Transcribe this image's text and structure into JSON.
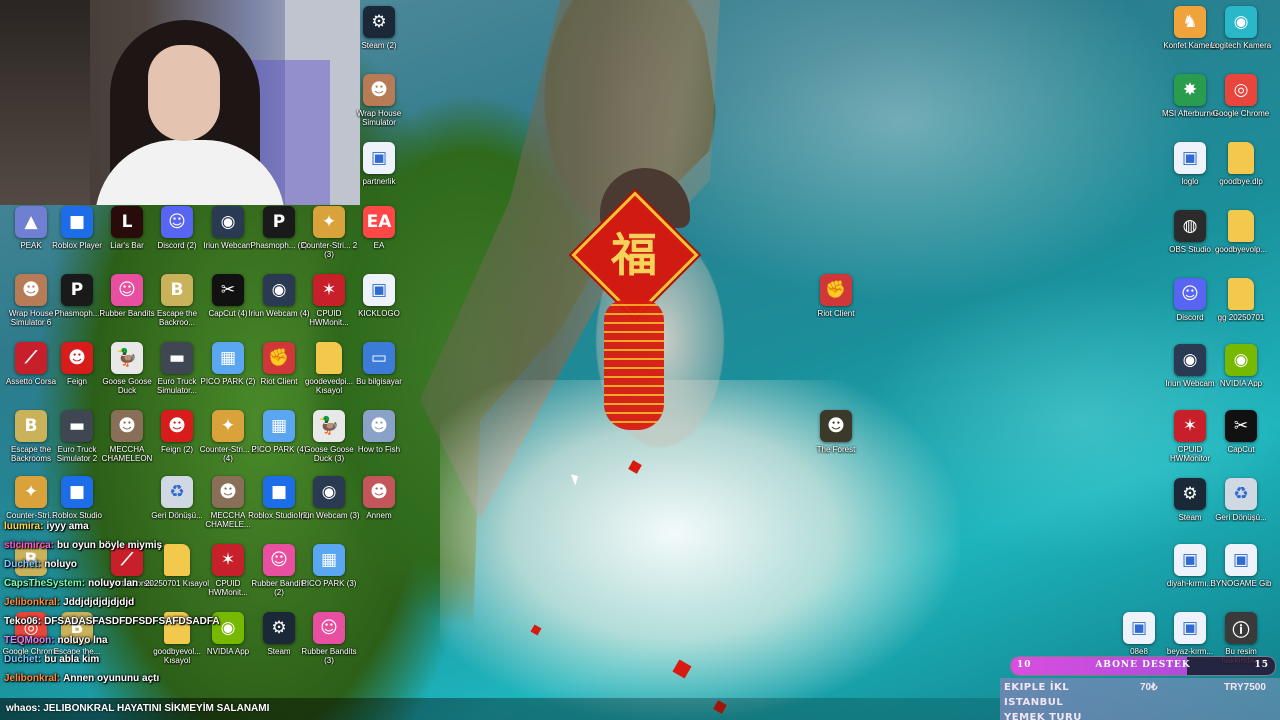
{
  "colors": {
    "steam": "#1b2838",
    "discord": "#5865f2",
    "roblox": "#1e6de8",
    "cpuid": "#c8202b",
    "riot": "#d13639",
    "ea": "#ff4747",
    "nvidia": "#76b900",
    "chrome": "#ffffff",
    "folder": "#f2c94c",
    "goal": "#c84fdc"
  },
  "desktop_icons": [
    {
      "label": "Steam (2)",
      "icon": "steam-icon",
      "col": 0
    },
    {
      "label": "Wrap House Simulator",
      "icon": "game-icon"
    },
    {
      "label": "partnerlik",
      "icon": "image-file-icon"
    },
    {
      "label": "PEAK",
      "icon": "peak-icon"
    },
    {
      "label": "Roblox Player",
      "icon": "roblox-icon"
    },
    {
      "label": "Liar's Bar",
      "icon": "liars-bar-icon"
    },
    {
      "label": "Discord (2)",
      "icon": "discord-icon"
    },
    {
      "label": "Iriun Webcam",
      "icon": "webcam-icon"
    },
    {
      "label": "Phasmoph... (2)",
      "icon": "phasmophobia-icon"
    },
    {
      "label": "Counter-Stri... 2 (3)",
      "icon": "counter-strike-icon"
    },
    {
      "label": "EA",
      "icon": "ea-icon"
    },
    {
      "label": "Wrap House Simulator 6",
      "icon": "game-icon"
    },
    {
      "label": "Phasmoph...",
      "icon": "phasmophobia-icon"
    },
    {
      "label": "Rubber Bandits",
      "icon": "rubber-bandits-icon"
    },
    {
      "label": "Escape the Backroo...",
      "icon": "backrooms-icon"
    },
    {
      "label": "CapCut (4)",
      "icon": "capcut-icon"
    },
    {
      "label": "Iriun Webcam (4)",
      "icon": "webcam-icon"
    },
    {
      "label": "CPUID HWMonit...",
      "icon": "cpuid-icon"
    },
    {
      "label": "KICKLOGO",
      "icon": "image-file-icon"
    },
    {
      "label": "Riot Client",
      "icon": "riot-icon"
    },
    {
      "label": "Assetto Corsa",
      "icon": "assetto-corsa-icon"
    },
    {
      "label": "Feign",
      "icon": "feign-icon"
    },
    {
      "label": "Goose Goose Duck",
      "icon": "goose-icon"
    },
    {
      "label": "Euro Truck Simulator...",
      "icon": "truck-icon"
    },
    {
      "label": "PICO PARK (2)",
      "icon": "pico-park-icon"
    },
    {
      "label": "Riot Client",
      "icon": "riot-icon"
    },
    {
      "label": "goodevedpi... Kısayol",
      "icon": "folder-icon"
    },
    {
      "label": "Bu bilgisayar",
      "icon": "computer-icon"
    },
    {
      "label": "Escape the Backrooms",
      "icon": "backrooms-icon"
    },
    {
      "label": "Euro Truck Simulator 2",
      "icon": "truck-icon"
    },
    {
      "label": "MECCHA CHAMELEON",
      "icon": "chameleon-icon"
    },
    {
      "label": "Feign (2)",
      "icon": "feign-icon"
    },
    {
      "label": "Counter-Stri... 2 (4)",
      "icon": "counter-strike-icon"
    },
    {
      "label": "PICO PARK (4)",
      "icon": "pico-park-icon"
    },
    {
      "label": "Goose Goose Duck (3)",
      "icon": "goose-icon"
    },
    {
      "label": "How to Fish",
      "icon": "fish-icon"
    },
    {
      "label": "The Forest",
      "icon": "forest-icon"
    },
    {
      "label": "Counter-Stri...",
      "icon": "counter-strike-icon"
    },
    {
      "label": "Roblox Studio",
      "icon": "roblox-icon"
    },
    {
      "label": "Geri Dönüşü...",
      "icon": "recycle-bin-icon"
    },
    {
      "label": "MECCHA CHAMELE...",
      "icon": "chameleon-icon"
    },
    {
      "label": "Roblox Studio (2)",
      "icon": "roblox-icon"
    },
    {
      "label": "Iriun Webcam (3)",
      "icon": "webcam-icon"
    },
    {
      "label": "Annem",
      "icon": "annem-icon"
    },
    {
      "label": "Backrooms",
      "icon": "backrooms-icon"
    },
    {
      "label": "Assetto Corsa",
      "icon": "assetto-corsa-icon"
    },
    {
      "label": "20250701 Kısayol",
      "icon": "folder-icon"
    },
    {
      "label": "CPUID HWMonit...",
      "icon": "cpuid-icon"
    },
    {
      "label": "Rubber Bandits (2)",
      "icon": "rubber-bandits-icon"
    },
    {
      "label": "PICO PARK (3)",
      "icon": "pico-park-icon"
    },
    {
      "label": "Google Chrome",
      "icon": "chrome-icon"
    },
    {
      "label": "Escape the...",
      "icon": "backrooms-icon"
    },
    {
      "label": "goodbyevol... Kısayol",
      "icon": "folder-icon"
    },
    {
      "label": "NVIDIA App",
      "icon": "nvidia-icon"
    },
    {
      "label": "Steam",
      "icon": "steam-icon"
    },
    {
      "label": "Rubber Bandits (3)",
      "icon": "rubber-bandits-icon"
    },
    {
      "label": "Konfet Kamera",
      "icon": "konfet-icon"
    },
    {
      "label": "Logitech Kamera",
      "icon": "logitech-icon"
    },
    {
      "label": "MSI Afterburner",
      "icon": "msi-icon"
    },
    {
      "label": "Google Chrome",
      "icon": "chrome-icon"
    },
    {
      "label": "loglo",
      "icon": "image-file-icon"
    },
    {
      "label": "goodbye.dlp",
      "icon": "folder-icon"
    },
    {
      "label": "OBS Studio",
      "icon": "obs-icon"
    },
    {
      "label": "goodbyevolp...",
      "icon": "folder-icon"
    },
    {
      "label": "Discord",
      "icon": "discord-icon"
    },
    {
      "label": "gg 20250701",
      "icon": "folder-icon"
    },
    {
      "label": "Iriun Webcam",
      "icon": "webcam-icon"
    },
    {
      "label": "NVIDIA App",
      "icon": "nvidia-icon"
    },
    {
      "label": "CPUID HWMonitor",
      "icon": "cpuid-icon"
    },
    {
      "label": "CapCut",
      "icon": "capcut-icon"
    },
    {
      "label": "Steam",
      "icon": "steam-icon"
    },
    {
      "label": "Geri Dönüşü...",
      "icon": "recycle-bin-icon"
    },
    {
      "label": "diyah-kırmı...",
      "icon": "image-file-icon"
    },
    {
      "label": "BYNOGAME Gib",
      "icon": "image-file-icon"
    },
    {
      "label": "08e8",
      "icon": "image-file-icon"
    },
    {
      "label": "beyaz-kırm...",
      "icon": "image-file-icon"
    },
    {
      "label": "Bu resim hakkında...",
      "icon": "info-icon"
    }
  ],
  "chat": [
    {
      "user": "luumira:",
      "text": "iyyy ama",
      "user_color": "#ffd84a"
    },
    {
      "user": "sticimirca:",
      "text": "bu oyun böyle miymiş",
      "user_color": "#ff5ad1"
    },
    {
      "user": "Duchet:",
      "text": "noluyo",
      "user_color": "#7ec8ff"
    },
    {
      "user": "CapsTheSystem:",
      "text": "noluyo lan",
      "user_color": "#7affb2"
    },
    {
      "user": "Jelibonkral:",
      "text": "Jddjdjdjdjdjdjd",
      "user_color": "#ff8c3a"
    },
    {
      "user": "Teko06:",
      "text": "DFSADASFASDFDFSDFSAFDSADFA",
      "user_color": "#ffffff"
    },
    {
      "user": "TEQMoon:",
      "text": "noluyo lna",
      "user_color": "#c58bff"
    },
    {
      "user": "Duchet:",
      "text": "bu abla kim",
      "user_color": "#7ec8ff"
    },
    {
      "user": "Jelibonkral:",
      "text": "Annen oyununu açtı",
      "user_color": "#ff8c3a"
    }
  ],
  "ticker": {
    "user": "whaos:",
    "text": "JELIBONKRAL HAYATINI SİKMEYİM SALANAMI"
  },
  "goal": {
    "current": "10",
    "label": "ABONE DESTEK",
    "target": "15",
    "progress": 0.667
  },
  "tracker": [
    {
      "label": "EKIPLE İKL",
      "value": "70₺"
    },
    {
      "label": "ISTANBUL",
      "value": "TRY7500"
    },
    {
      "label": "YEMEK TURU",
      "value": ""
    }
  ],
  "wallpaper": {
    "fu_char": "福"
  }
}
